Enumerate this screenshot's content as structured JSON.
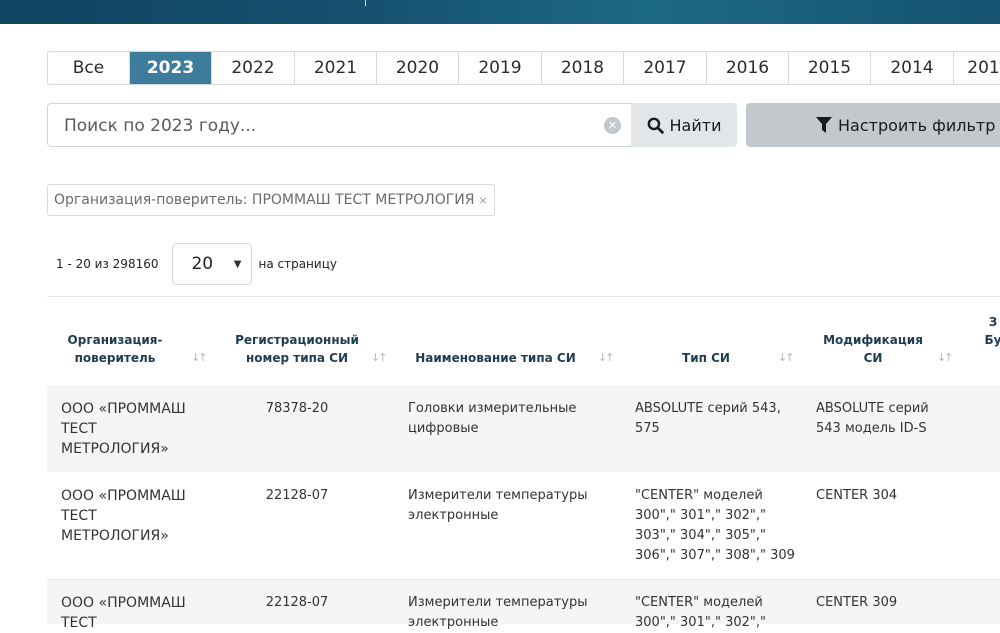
{
  "years": [
    "Все",
    "2023",
    "2022",
    "2021",
    "2020",
    "2019",
    "2018",
    "2017",
    "2016",
    "2015",
    "2014",
    "201"
  ],
  "active_year": "2023",
  "search": {
    "placeholder": "Поиск по 2023 году...",
    "find_label": "Найти",
    "filter_label": "Настроить фильтр"
  },
  "filter_chip": {
    "label": "Организация-поверитель: ПРОММАШ ТЕСТ МЕТРОЛОГИЯ",
    "remove": "×"
  },
  "pagination": {
    "range": "1 - 20 из 298160",
    "per_page": "20",
    "per_page_label": "на страницу"
  },
  "table": {
    "headers": {
      "org": [
        "Организация-",
        "поверитель"
      ],
      "reg": [
        "Регистрационный",
        "номер типа СИ"
      ],
      "name": [
        "Наименование типа СИ"
      ],
      "type": [
        "Тип СИ"
      ],
      "mod": [
        "Модификация",
        "СИ"
      ],
      "extra": [
        "З",
        "Бу"
      ]
    },
    "rows": [
      {
        "org": [
          "ООО «ПРОММАШ",
          "ТЕСТ",
          "МЕТРОЛОГИЯ»"
        ],
        "reg": "78378-20",
        "name": [
          "Головки измерительные",
          "цифровые"
        ],
        "type": [
          "ABSOLUTE серий 543,",
          "575"
        ],
        "mod": [
          "ABSOLUTE серий",
          "543 модель ID-S"
        ]
      },
      {
        "org": [
          "ООО «ПРОММАШ",
          "ТЕСТ",
          "МЕТРОЛОГИЯ»"
        ],
        "reg": "22128-07",
        "name": [
          "Измерители температуры",
          "электронные"
        ],
        "type": [
          "\"CENTER\" моделей",
          "300\",\" 301\",\" 302\",\"",
          "303\",\" 304\",\" 305\",\"",
          "306\",\" 307\",\" 308\",\" 309"
        ],
        "mod": [
          "CENTER 304"
        ]
      },
      {
        "org": [
          "ООО «ПРОММАШ",
          "ТЕСТ"
        ],
        "reg": "22128-07",
        "name": [
          "Измерители температуры",
          "электронные"
        ],
        "type": [
          "\"CENTER\" моделей",
          "300\",\" 301\",\" 302\",\""
        ],
        "mod": [
          "CENTER 309"
        ]
      }
    ]
  }
}
